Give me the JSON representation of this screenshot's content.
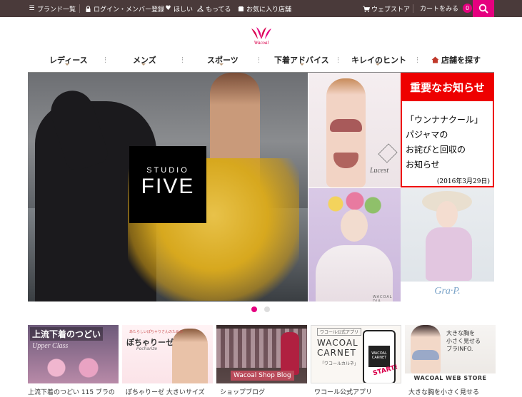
{
  "topbar": {
    "brands": "ブランド一覧",
    "login": "ログイン・メンバー登録",
    "wishlist": "ほしい",
    "owned": "もってる",
    "favorite_store": "お気に入り店舗",
    "webstore": "ウェブストア",
    "cart": "カートをみる",
    "cart_count": "0"
  },
  "logo": {
    "text": "Wacoal"
  },
  "nav": {
    "items": [
      "レディース",
      "メンズ",
      "スポーツ",
      "下着アドバイス",
      "キレイのヒント"
    ],
    "store_search": "店舗を探す"
  },
  "hero": {
    "studio": "STUDIO",
    "five": "FIVE"
  },
  "tiles": {
    "lucest_brand": "Lucest",
    "dia_brand": "WACOAL DIA",
    "grap_brand": "Gra·P."
  },
  "notice": {
    "header": "重要なお知らせ",
    "lines": [
      "「ウンナナクール」",
      "パジャマの",
      "お詫びと回収の",
      "お知らせ"
    ],
    "date": "(2016年3月29日)"
  },
  "carousel": {
    "active_index": 0,
    "count": 2
  },
  "cards": [
    {
      "title": "上流下着のつどい",
      "subtitle": "Upper Class",
      "caption": "上流下着のつどい 115 ブラの"
    },
    {
      "small": "あたらしいぽちゃりさんのための",
      "title": "ぽちゃりーゼ",
      "subtitle": "Pocharize",
      "caption": "ぽちゃりーゼ 大きいサイズ"
    },
    {
      "title": "Wacoal Shop Blog",
      "caption": "ショップブログ"
    },
    {
      "header": "ワコール公式アプリ",
      "title": "WACOAL",
      "title2": "CARNET",
      "title3": "「ワコールカルネ」",
      "start": "START!",
      "caption": "ワコール公式アプリ"
    },
    {
      "text": "大きな胸を\n小さく見せる\nブラINFO.",
      "ws": "WACOAL WEB STORE",
      "caption": "大きな胸を小さく見せる"
    }
  ],
  "colors": {
    "topbar": "#4a3a3a",
    "accent": "#e5007f",
    "notice_red": "#ee0000",
    "brand_red": "#d9004c"
  }
}
